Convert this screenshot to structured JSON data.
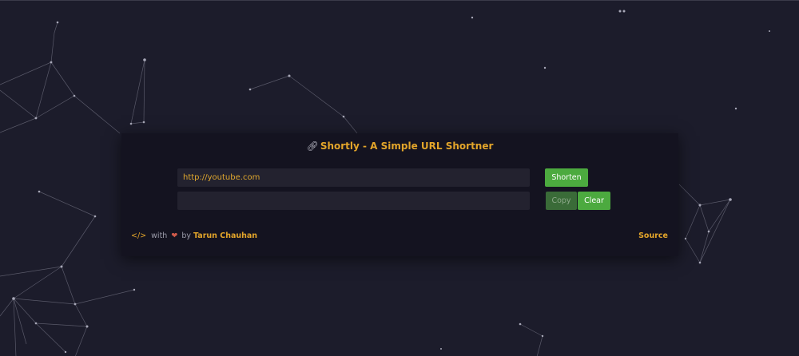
{
  "app": {
    "title": "Shortly - A Simple URL Shortner",
    "title_icon": "link-icon"
  },
  "form": {
    "url_value": "http://youtube.com",
    "short_value": "",
    "shorten_label": "Shorten",
    "copy_label": "Copy",
    "clear_label": "Clear"
  },
  "footer": {
    "code_icon_text": "</>",
    "with_text": "with",
    "heart_icon": "heart-icon",
    "by_text": "by",
    "author": "Tarun Chauhan",
    "source_label": "Source"
  },
  "colors": {
    "background": "#1c1c2b",
    "card": "#141320",
    "accent": "#e3a52a",
    "button": "#4caa3f",
    "particles": "#8a8a9a"
  }
}
